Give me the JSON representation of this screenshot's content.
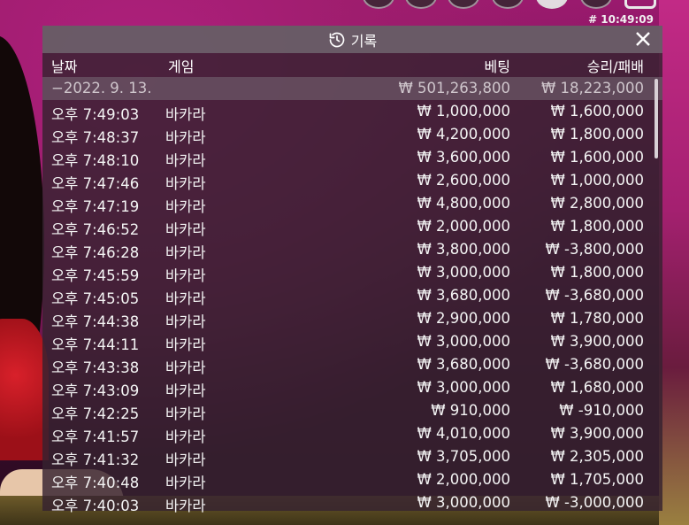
{
  "clock": "# 10:49:09",
  "panel": {
    "title": "기록",
    "close_icon": "×"
  },
  "columns": {
    "date": "날짜",
    "game": "게임",
    "bet": "베팅",
    "winloss": "승리/패배"
  },
  "total": {
    "date": "−2022. 9. 13.",
    "bet": "₩ 501,263,800",
    "winloss": "₩ 18,223,000"
  },
  "rows": [
    {
      "time": "오후 7:49:03",
      "game": "바카라",
      "bet": "₩ 1,000,000",
      "winloss": "₩ 1,600,000"
    },
    {
      "time": "오후 7:48:37",
      "game": "바카라",
      "bet": "₩ 4,200,000",
      "winloss": "₩ 1,800,000"
    },
    {
      "time": "오후 7:48:10",
      "game": "바카라",
      "bet": "₩ 3,600,000",
      "winloss": "₩ 1,600,000"
    },
    {
      "time": "오후 7:47:46",
      "game": "바카라",
      "bet": "₩ 2,600,000",
      "winloss": "₩ 1,000,000"
    },
    {
      "time": "오후 7:47:19",
      "game": "바카라",
      "bet": "₩ 4,800,000",
      "winloss": "₩ 2,800,000"
    },
    {
      "time": "오후 7:46:52",
      "game": "바카라",
      "bet": "₩ 2,000,000",
      "winloss": "₩ 1,800,000"
    },
    {
      "time": "오후 7:46:28",
      "game": "바카라",
      "bet": "₩ 3,800,000",
      "winloss": "₩ -3,800,000"
    },
    {
      "time": "오후 7:45:59",
      "game": "바카라",
      "bet": "₩ 3,000,000",
      "winloss": "₩ 1,800,000"
    },
    {
      "time": "오후 7:45:05",
      "game": "바카라",
      "bet": "₩ 3,680,000",
      "winloss": "₩ -3,680,000"
    },
    {
      "time": "오후 7:44:38",
      "game": "바카라",
      "bet": "₩ 2,900,000",
      "winloss": "₩ 1,780,000"
    },
    {
      "time": "오후 7:44:11",
      "game": "바카라",
      "bet": "₩ 3,000,000",
      "winloss": "₩ 3,900,000"
    },
    {
      "time": "오후 7:43:38",
      "game": "바카라",
      "bet": "₩ 3,680,000",
      "winloss": "₩ -3,680,000"
    },
    {
      "time": "오후 7:43:09",
      "game": "바카라",
      "bet": "₩ 3,000,000",
      "winloss": "₩ 1,680,000"
    },
    {
      "time": "오후 7:42:25",
      "game": "바카라",
      "bet": "₩ 910,000",
      "winloss": "₩ -910,000"
    },
    {
      "time": "오후 7:41:57",
      "game": "바카라",
      "bet": "₩ 4,010,000",
      "winloss": "₩ 3,900,000"
    },
    {
      "time": "오후 7:41:32",
      "game": "바카라",
      "bet": "₩ 3,705,000",
      "winloss": "₩ 2,305,000"
    },
    {
      "time": "오후 7:40:48",
      "game": "바카라",
      "bet": "₩ 2,000,000",
      "winloss": "₩ 1,705,000"
    },
    {
      "time": "오후 7:40:03",
      "game": "바카라",
      "bet": "₩ 3,000,000",
      "winloss": "₩ -3,000,000"
    }
  ]
}
